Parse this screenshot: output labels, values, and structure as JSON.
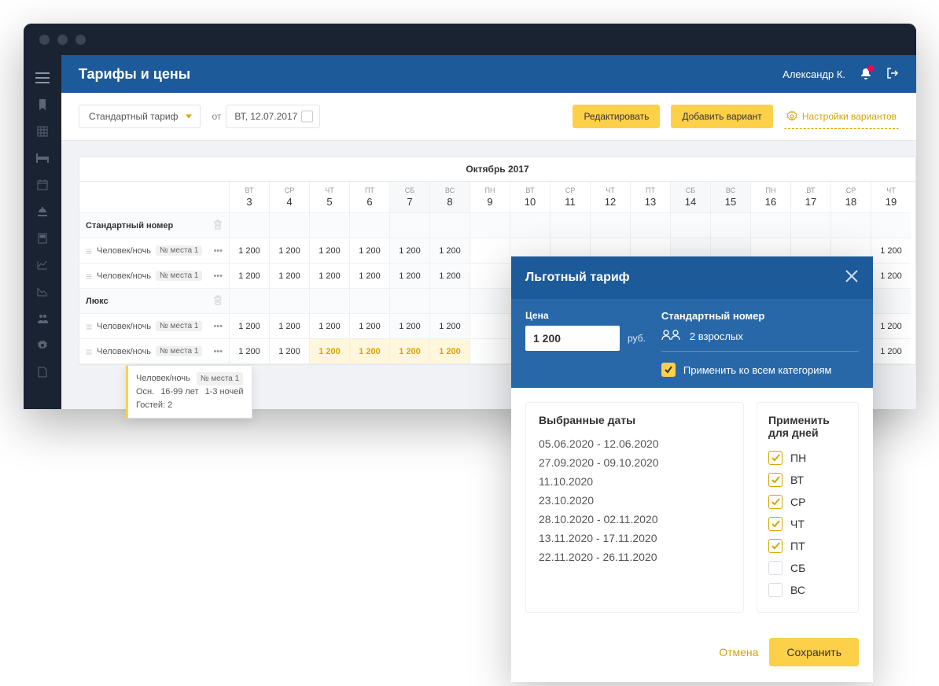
{
  "page_title": "Тарифы и цены",
  "user_name": "Александр К.",
  "toolbar": {
    "tariff_select": "Стандартный тариф",
    "from_label": "от",
    "date_value": "ВТ, 12.07.2017",
    "edit_label": "Редактировать",
    "add_variant_label": "Добавить вариант",
    "settings_label": "Настройки вариантов"
  },
  "grid": {
    "month_label": "Октябрь 2017",
    "days": [
      {
        "name": "ВТ",
        "num": "3",
        "weekend": false
      },
      {
        "name": "СР",
        "num": "4",
        "weekend": false
      },
      {
        "name": "ЧТ",
        "num": "5",
        "weekend": false
      },
      {
        "name": "ПТ",
        "num": "6",
        "weekend": false
      },
      {
        "name": "СБ",
        "num": "7",
        "weekend": true
      },
      {
        "name": "ВС",
        "num": "8",
        "weekend": true
      },
      {
        "name": "ПН",
        "num": "9",
        "weekend": false
      },
      {
        "name": "ВТ",
        "num": "10",
        "weekend": false
      },
      {
        "name": "СР",
        "num": "11",
        "weekend": false
      },
      {
        "name": "ЧТ",
        "num": "12",
        "weekend": false
      },
      {
        "name": "ПТ",
        "num": "13",
        "weekend": false
      },
      {
        "name": "СБ",
        "num": "14",
        "weekend": true
      },
      {
        "name": "ВС",
        "num": "15",
        "weekend": true
      },
      {
        "name": "ПН",
        "num": "16",
        "weekend": false
      },
      {
        "name": "ВТ",
        "num": "17",
        "weekend": false
      },
      {
        "name": "СР",
        "num": "18",
        "weekend": false
      },
      {
        "name": "ЧТ",
        "num": "19",
        "weekend": false
      }
    ],
    "categories": [
      {
        "name": "Стандартный номер",
        "rows": [
          {
            "label": "Человек/ночь",
            "badge": "№ места 1",
            "values": [
              "1 200",
              "1 200",
              "1 200",
              "1 200",
              "1 200",
              "1 200",
              "",
              "",
              "",
              "",
              "",
              "",
              "",
              "",
              "",
              "",
              "1 200"
            ]
          },
          {
            "label": "Человек/ночь",
            "badge": "№ места 1",
            "values": [
              "1 200",
              "1 200",
              "1 200",
              "1 200",
              "1 200",
              "1 200",
              "",
              "",
              "",
              "",
              "",
              "",
              "",
              "",
              "",
              "",
              "1 200"
            ]
          }
        ]
      },
      {
        "name": "Люкс",
        "rows": [
          {
            "label": "Человек/ночь",
            "badge": "№ места 1",
            "values": [
              "1 200",
              "1 200",
              "1 200",
              "1 200",
              "1 200",
              "1 200",
              "",
              "",
              "",
              "",
              "",
              "",
              "",
              "",
              "",
              "",
              "1 200"
            ]
          },
          {
            "label": "Человек/ночь",
            "badge": "№ места 1",
            "values": [
              "1 200",
              "1 200",
              "1 200",
              "1 200",
              "1 200",
              "1 200",
              "",
              "",
              "",
              "",
              "",
              "",
              "",
              "",
              "",
              "",
              "1 200"
            ],
            "highlight": [
              2,
              3,
              4,
              5
            ]
          }
        ]
      }
    ]
  },
  "tooltip": {
    "line1_a": "Человек/ночь",
    "line1_b": "№ места 1",
    "line2_a": "Осн.",
    "line2_b": "16-99 лет",
    "line2_c": "1-3 ночей",
    "line3": "Гостей: 2"
  },
  "modal": {
    "title": "Льготный тариф",
    "price_label": "Цена",
    "price_value": "1 200",
    "price_unit": "руб.",
    "room_name": "Стандартный номер",
    "guests_label": "2 взрослых",
    "apply_all_label": "Применить ко всем категориям",
    "dates_title": "Выбранные даты",
    "dates": [
      "05.06.2020 - 12.06.2020",
      "27.09.2020 - 09.10.2020",
      "11.10.2020",
      "23.10.2020",
      "28.10.2020 - 02.11.2020",
      "13.11.2020 - 17.11.2020",
      "22.11.2020 - 26.11.2020"
    ],
    "days_title": "Применить для дней",
    "days": [
      {
        "label": "ПН",
        "on": true
      },
      {
        "label": "ВТ",
        "on": true
      },
      {
        "label": "СР",
        "on": true
      },
      {
        "label": "ЧТ",
        "on": true
      },
      {
        "label": "ПТ",
        "on": true
      },
      {
        "label": "СБ",
        "on": false
      },
      {
        "label": "ВС",
        "on": false
      }
    ],
    "cancel_label": "Отмена",
    "save_label": "Сохранить"
  }
}
